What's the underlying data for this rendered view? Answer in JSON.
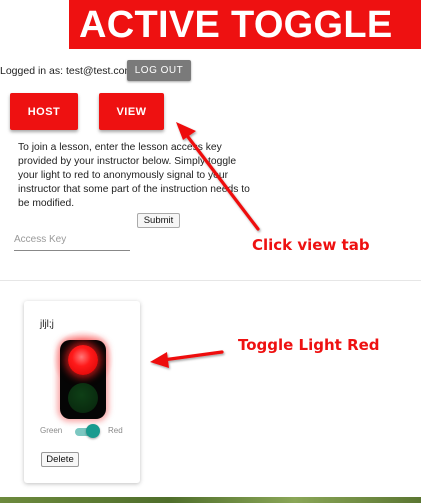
{
  "header": {
    "title": "ACTIVE TOGGLE"
  },
  "user": {
    "logged_in_text": "Logged in as: test@test.com",
    "logout_label": "LOG OUT"
  },
  "tabs": [
    {
      "label": "HOST"
    },
    {
      "label": "VIEW"
    }
  ],
  "join": {
    "instructions": "To join a lesson, enter the lesson access key provided by your instructor below. Simply toggle your light to red to anonymously signal to your instructor that some part of the instruction needs to be modified.",
    "submit_label": "Submit",
    "access_key_placeholder": "Access Key",
    "access_key_value": ""
  },
  "lesson_card": {
    "name": "jljl;j",
    "light_state": "red",
    "toggle_left_label": "Green",
    "toggle_right_label": "Red",
    "toggle_on": true,
    "delete_label": "Delete"
  },
  "annotations": {
    "view_hint": "Click view tab",
    "toggle_hint": "Toggle Light Red"
  },
  "colors": {
    "brand_red": "#ee1111",
    "logout_gray": "#7a7a7a",
    "switch_thumb": "#199b8f",
    "switch_track": "#7cc7c1"
  },
  "icons": {
    "traffic_light": "traffic-light-icon",
    "arrow_to_view": "arrow-icon",
    "arrow_to_light": "arrow-icon"
  }
}
